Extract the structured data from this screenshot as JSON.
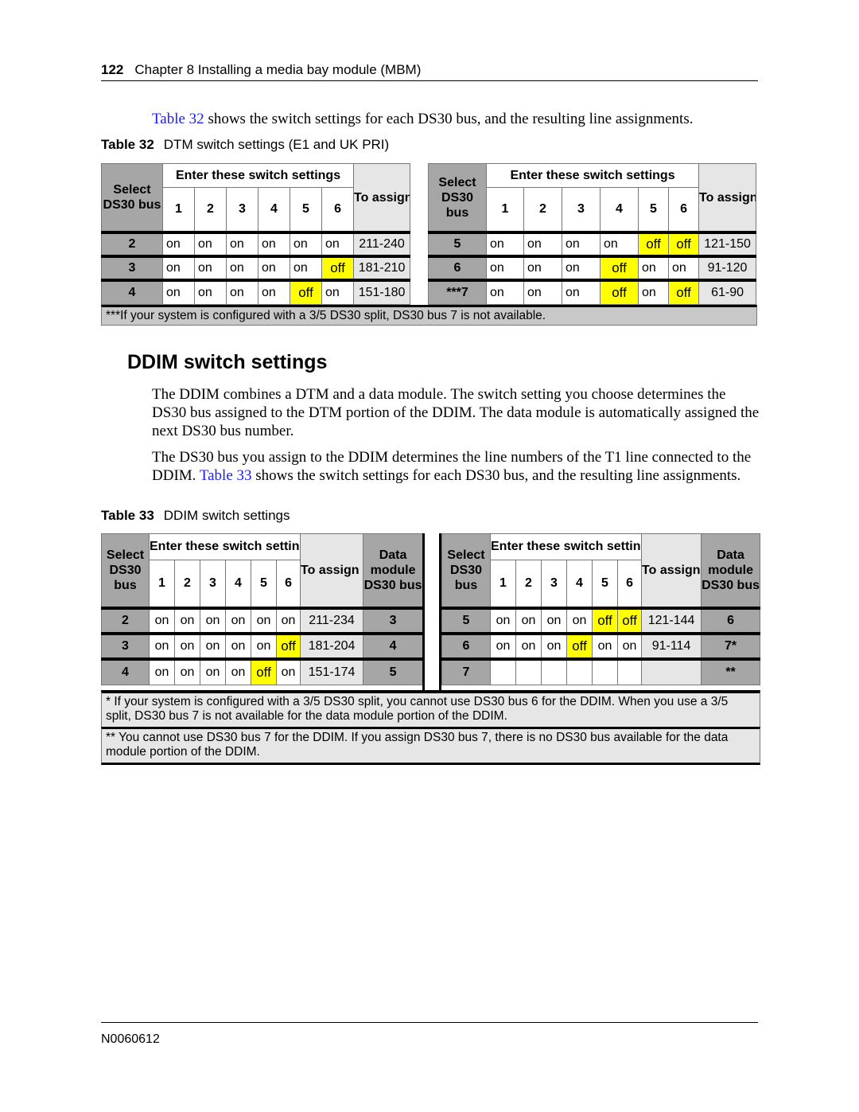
{
  "header": {
    "page_number": "122",
    "chapter": "Chapter 8  Installing a media bay module (MBM)"
  },
  "intro": {
    "link": "Table 32",
    "text": " shows the switch settings for each DS30 bus, and the resulting line assignments."
  },
  "table32": {
    "caption_num": "Table 32",
    "caption": "DTM switch settings (E1 and UK PRI)",
    "h_select": "Select DS30 bus",
    "h_switch": "Enter these switch settings",
    "h_lines": "To assign these lines",
    "switch_nums": [
      "1",
      "2",
      "3",
      "4",
      "5",
      "6"
    ],
    "left": [
      {
        "bus": "2",
        "sw": [
          "on",
          "on",
          "on",
          "on",
          "on",
          "on"
        ],
        "lines": "211-240"
      },
      {
        "bus": "3",
        "sw": [
          "on",
          "on",
          "on",
          "on",
          "on",
          "off"
        ],
        "lines": "181-210"
      },
      {
        "bus": "4",
        "sw": [
          "on",
          "on",
          "on",
          "on",
          "off",
          "on"
        ],
        "lines": "151-180"
      }
    ],
    "right": [
      {
        "bus": "5",
        "sw": [
          "on",
          "on",
          "on",
          "on",
          "off",
          "off"
        ],
        "lines": "121-150"
      },
      {
        "bus": "6",
        "sw": [
          "on",
          "on",
          "on",
          "off",
          "on",
          "on"
        ],
        "lines": "91-120"
      },
      {
        "bus": "***7",
        "sw": [
          "on",
          "on",
          "on",
          "off",
          "on",
          "off"
        ],
        "lines": "61-90"
      }
    ],
    "footnote": "***If your system is configured with a 3/5 DS30 split, DS30 bus 7 is not available."
  },
  "section": {
    "title": "DDIM switch settings",
    "p1": "The DDIM combines a DTM and a data module. The switch setting you choose determines the DS30 bus assigned to the DTM portion of the DDIM. The data module is automatically assigned the next DS30 bus number.",
    "p2a": "The DS30 bus you assign to the DDIM determines the line numbers of the T1 line connected to the DDIM. ",
    "p2link": "Table 33",
    "p2b": " shows the switch settings for each DS30 bus, and the resulting line assignments."
  },
  "table33": {
    "caption_num": "Table 33",
    "caption": "DDIM switch settings",
    "h_select": "Select DS30 bus",
    "h_switch": "Enter these switch settings",
    "h_lines": "To assign these lines",
    "h_data": "Data module DS30 bus",
    "switch_nums": [
      "1",
      "2",
      "3",
      "4",
      "5",
      "6"
    ],
    "left": [
      {
        "bus": "2",
        "sw": [
          "on",
          "on",
          "on",
          "on",
          "on",
          "on"
        ],
        "lines": "211-234",
        "data": "3"
      },
      {
        "bus": "3",
        "sw": [
          "on",
          "on",
          "on",
          "on",
          "on",
          "off"
        ],
        "lines": "181-204",
        "data": "4"
      },
      {
        "bus": "4",
        "sw": [
          "on",
          "on",
          "on",
          "on",
          "off",
          "on"
        ],
        "lines": "151-174",
        "data": "5"
      }
    ],
    "right": [
      {
        "bus": "5",
        "sw": [
          "on",
          "on",
          "on",
          "on",
          "off",
          "off"
        ],
        "lines": "121-144",
        "data": "6"
      },
      {
        "bus": "6",
        "sw": [
          "on",
          "on",
          "on",
          "off",
          "on",
          "on"
        ],
        "lines": "91-114",
        "data": "7*"
      },
      {
        "bus": "7",
        "sw": [
          "",
          "",
          "",
          "",
          "",
          ""
        ],
        "lines": "",
        "data": "**"
      }
    ],
    "footnote1": "* If your system is configured with a 3/5 DS30 split, you cannot use DS30 bus 6 for the DDIM. When you use a 3/5 split, DS30 bus 7 is not available for the data module portion of the DDIM.",
    "footnote2": "** You cannot use DS30 bus 7 for the DDIM. If you assign DS30 bus 7, there is no DS30 bus available for the data module portion of the DDIM."
  },
  "footer": {
    "doc_id": "N0060612"
  },
  "colors": {
    "highlight": "#ffff00",
    "select_col": "#a6a6a6",
    "lines_col": "#e6e6e6",
    "link": "#1a1aff"
  }
}
